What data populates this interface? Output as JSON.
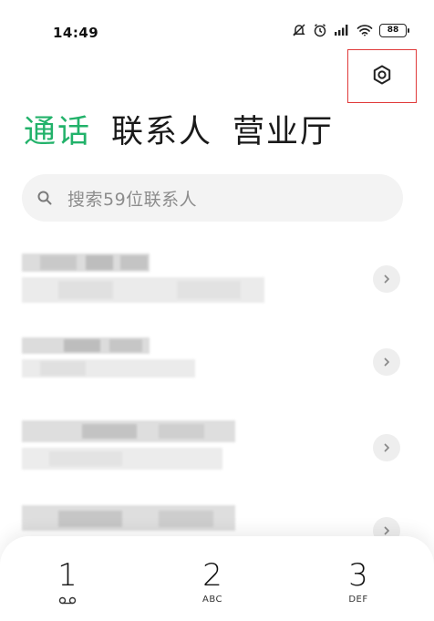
{
  "status_bar": {
    "time": "14:49",
    "battery_level": "88",
    "icons": [
      "notification-off-icon",
      "alarm-icon",
      "signal-icon",
      "wifi-icon",
      "battery-icon"
    ]
  },
  "header": {
    "settings_icon": "settings-hexagon-icon",
    "accent_color": "#22b26a",
    "highlight_box_color": "#e03a3a"
  },
  "tabs": [
    {
      "label": "通话",
      "active": true
    },
    {
      "label": "联系人",
      "active": false
    },
    {
      "label": "营业厅",
      "active": false
    }
  ],
  "search": {
    "placeholder": "搜索59位联系人"
  },
  "contacts": [
    {
      "name": "",
      "detail": "",
      "chevron_icon": "chevron-right-icon"
    },
    {
      "name": "",
      "detail": "",
      "chevron_icon": "chevron-right-icon"
    },
    {
      "name": "",
      "detail": "",
      "chevron_icon": "chevron-right-icon"
    },
    {
      "name": "",
      "detail": "",
      "chevron_icon": "chevron-right-icon"
    }
  ],
  "dialpad": {
    "keys": [
      {
        "digit": "1",
        "letters": "",
        "icon": "voicemail-icon"
      },
      {
        "digit": "2",
        "letters": "ABC"
      },
      {
        "digit": "3",
        "letters": "DEF"
      }
    ]
  }
}
